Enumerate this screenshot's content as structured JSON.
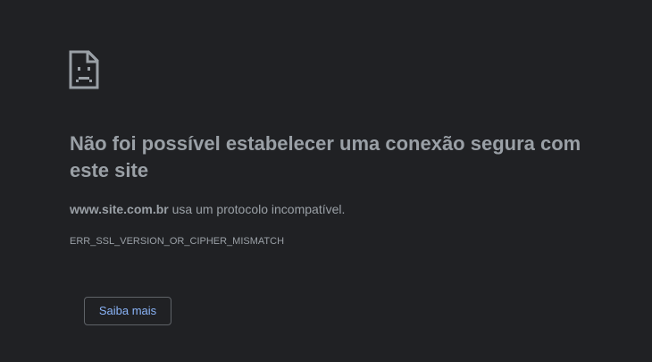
{
  "error_page": {
    "icon": "sad-page-icon",
    "title": "Não foi possível estabelecer uma conexão segura com este site",
    "description_domain": "www.site.com.br",
    "description_text": " usa um protocolo incompatível.",
    "error_code": "ERR_SSL_VERSION_OR_CIPHER_MISMATCH",
    "learn_more_label": "Saiba mais"
  },
  "colors": {
    "background": "#202124",
    "text": "#9aa0a6",
    "link": "#8ab4f8",
    "button_border": "#5f6368"
  }
}
